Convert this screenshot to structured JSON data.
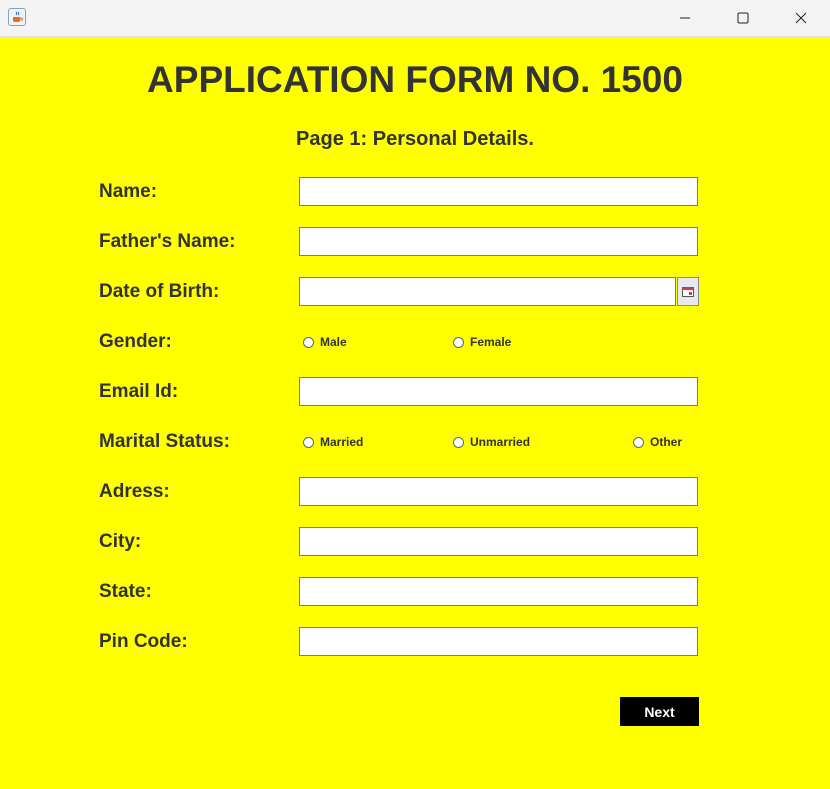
{
  "window": {
    "app_icon": "java-cup-icon",
    "controls": [
      "minimize-icon",
      "maximize-icon",
      "close-icon"
    ]
  },
  "form": {
    "title": "APPLICATION FORM NO. 1500",
    "page_heading": "Page 1: Personal Details.",
    "labels": {
      "name": "Name:",
      "father_name": "Father's Name:",
      "dob": "Date of Birth:",
      "gender": "Gender:",
      "email": "Email Id:",
      "marital_status": "Marital Status:",
      "address": "Adress:",
      "city": "City:",
      "state": "State:",
      "pin_code": "Pin Code:"
    },
    "values": {
      "name": "",
      "father_name": "",
      "dob": "",
      "email": "",
      "address": "",
      "city": "",
      "state": "",
      "pin_code": ""
    },
    "gender_options": [
      "Male",
      "Female"
    ],
    "marital_options": [
      "Married",
      "Unmarried",
      "Other"
    ],
    "next_label": "Next"
  },
  "colors": {
    "background": "#ffff00",
    "text": "#333333",
    "button_bg": "#000000",
    "button_text": "#ffffff"
  }
}
